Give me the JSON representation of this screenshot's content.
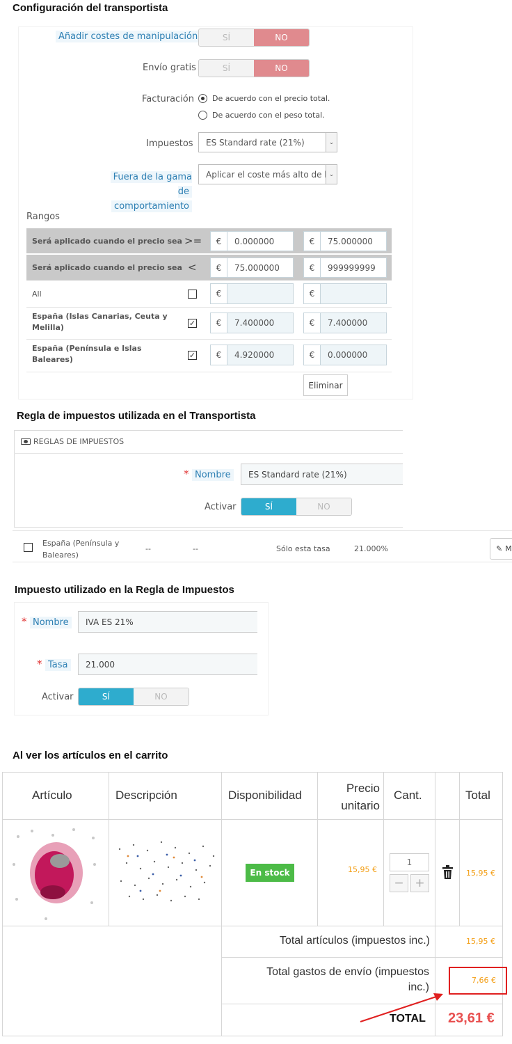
{
  "section1": {
    "title": "Configuración del transportista",
    "handling": {
      "label": "Añadir costes de manipulación",
      "yes": "SÍ",
      "no": "NO"
    },
    "free": {
      "label": "Envío gratis",
      "yes": "SÍ",
      "no": "NO"
    },
    "billing": {
      "label": "Facturación",
      "opt1": "De acuerdo con el precio total.",
      "opt2": "De acuerdo con el peso total."
    },
    "tax": {
      "label": "Impuestos",
      "value": "ES Standard rate (21%)"
    },
    "oor": {
      "label1": "Fuera de la gama de",
      "label2": "comportamiento",
      "value": "Aplicar el coste más alto de la"
    },
    "ranges": {
      "title": "Rangos",
      "row_ge": {
        "label": "Será aplicado cuando el precio sea",
        "op": ">=",
        "currency": "€",
        "from": "0.000000",
        "to": "75.000000"
      },
      "row_lt": {
        "label": "Será aplicado cuando el precio sea",
        "op": "<",
        "currency": "€",
        "from": "75.000000",
        "to": "999999999"
      },
      "zones": [
        {
          "name": "All",
          "v1": "",
          "v2": ""
        },
        {
          "name1": "España (Islas Canarias, Ceuta y",
          "name2": "Melilla)",
          "v1": "7.400000",
          "v2": "7.400000",
          "check": "✓"
        },
        {
          "name1": "España (Península e Islas",
          "name2": "Baleares)",
          "v1": "4.920000",
          "v2": "0.000000",
          "check": "✓"
        }
      ],
      "delete": "Eliminar"
    }
  },
  "section2": {
    "title": "Regla de impuestos utilizada en el Transportista",
    "panel_title": "REGLAS DE IMPUESTOS",
    "name_label": "Nombre",
    "name_value": "ES Standard rate (21%)",
    "active_label": "Activar",
    "yes": "SÍ",
    "no": "NO",
    "row": {
      "country1": "España (Península y",
      "country2": "Baleares)",
      "c1": "--",
      "c2": "--",
      "behavior": "Sólo esta tasa",
      "rate": "21.000%",
      "btn": "M"
    }
  },
  "section3": {
    "title": "Impuesto utilizado en la Regla de Impuestos",
    "name_label": "Nombre",
    "name_value": "IVA ES 21%",
    "rate_label": "Tasa",
    "rate_value": "21.000",
    "active_label": "Activar",
    "yes": "SÍ",
    "no": "NO"
  },
  "section4": {
    "title": "Al ver los artículos en el carrito",
    "headers": {
      "article": "Artículo",
      "desc": "Descripción",
      "avail": "Disponibilidad",
      "price1": "Precio",
      "price2": "unitario",
      "qty": "Cant.",
      "total": "Total"
    },
    "item": {
      "stock": "En stock",
      "price": "15,95 €",
      "qty": "1",
      "minus": "−",
      "plus": "+",
      "total": "15,95 €"
    },
    "totals": {
      "products_label": "Total artículos (impuestos inc.)",
      "products_value": "15,95 €",
      "shipping_label1": "Total gastos de envío (impuestos",
      "shipping_label2": "inc.)",
      "shipping_value": "7,66 €",
      "total_label": "TOTAL",
      "total_value": "23,61 €"
    }
  },
  "colors": {
    "red_switch": "#e08a8e",
    "blue_switch": "#2eacce",
    "stock_green": "#4cbb47",
    "price_orange": "#f39d12",
    "highlight_red": "#e02020"
  }
}
